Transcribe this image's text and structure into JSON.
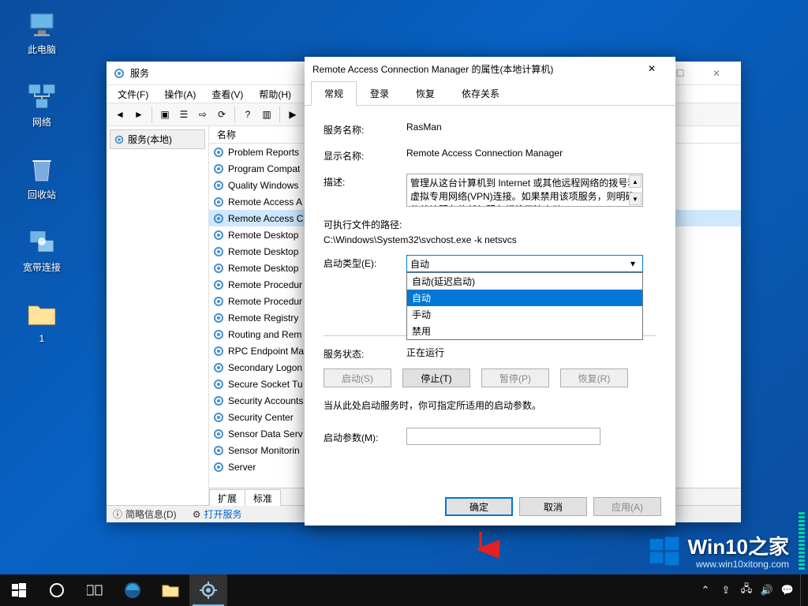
{
  "desktop": {
    "icons": [
      {
        "name": "pc",
        "label": "此电脑"
      },
      {
        "name": "network",
        "label": "网络"
      },
      {
        "name": "recycle",
        "label": "回收站"
      },
      {
        "name": "broadband",
        "label": "宽带连接"
      },
      {
        "name": "folder1",
        "label": "1"
      }
    ]
  },
  "services_window": {
    "title": "服务",
    "menu": [
      "文件(F)",
      "操作(A)",
      "查看(V)",
      "帮助(H)"
    ],
    "left_panel_label": "服务(本地)",
    "column_header": "名称",
    "rows": [
      "Problem Reports",
      "Program Compat",
      "Quality Windows",
      "Remote Access A",
      "Remote Access C",
      "Remote Desktop",
      "Remote Desktop",
      "Remote Desktop",
      "Remote Procedur",
      "Remote Procedur",
      "Remote Registry",
      "Routing and Rem",
      "RPC Endpoint Ma",
      "Secondary Logon",
      "Secure Socket Tu",
      "Security Accounts",
      "Security Center",
      "Sensor Data Serv",
      "Sensor Monitorin",
      "Server"
    ],
    "selected_index": 4,
    "bottom_tabs": [
      "扩展",
      "标准"
    ],
    "status_left": "简略信息(D)",
    "status_link": "打开服务"
  },
  "properties_dialog": {
    "title": "Remote Access Connection Manager 的属性(本地计算机)",
    "tabs": [
      "常规",
      "登录",
      "恢复",
      "依存关系"
    ],
    "active_tab": 0,
    "service_name_label": "服务名称:",
    "service_name_value": "RasMan",
    "display_name_label": "显示名称:",
    "display_name_value": "Remote Access Connection Manager",
    "description_label": "描述:",
    "description_value": "管理从这台计算机到 Internet 或其他远程网络的拨号和虚拟专用网络(VPN)连接。如果禁用该项服务，则明确依赖该服务的任何服务都将无法启动",
    "executable_label": "可执行文件的路径:",
    "executable_value": "C:\\Windows\\System32\\svchost.exe -k netsvcs",
    "startup_type_label": "启动类型(E):",
    "startup_type_value": "自动",
    "startup_options": [
      "自动(延迟启动)",
      "自动",
      "手动",
      "禁用"
    ],
    "startup_highlighted": 1,
    "service_status_label": "服务状态:",
    "service_status_value": "正在运行",
    "buttons": {
      "start": "启动(S)",
      "stop": "停止(T)",
      "pause": "暂停(P)",
      "resume": "恢复(R)"
    },
    "hint_text": "当从此处启动服务时，你可指定所适用的启动参数。",
    "start_params_label": "启动参数(M):",
    "footer": {
      "ok": "确定",
      "cancel": "取消",
      "apply": "应用(A)"
    }
  },
  "watermark": {
    "text": "Win10之家",
    "url": "www.win10xitong.com"
  }
}
